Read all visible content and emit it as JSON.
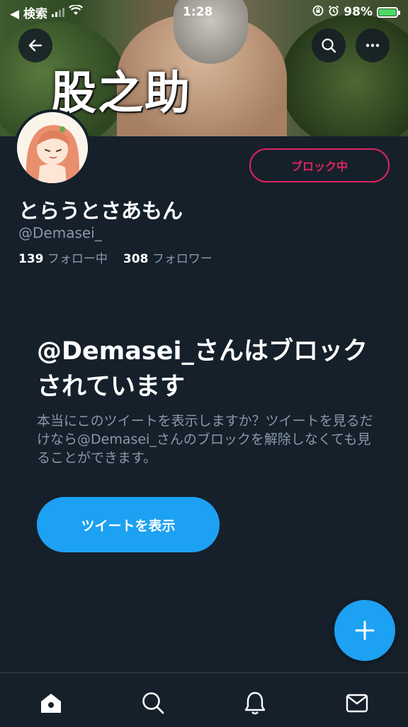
{
  "status_bar": {
    "back_app": "◀ 検索",
    "time": "1:28",
    "battery": "98%"
  },
  "banner": {
    "caption": "股之助"
  },
  "profile": {
    "display_name": "とらうとさあもん",
    "handle": "@Demasei_",
    "following_count": "139",
    "following_label": "フォロー中",
    "followers_count": "308",
    "followers_label": "フォロワー",
    "blocked_button_label": "ブロック中"
  },
  "blocked_notice": {
    "heading": "@Demasei_さんはブロックされています",
    "description": "本当にこのツイートを表示しますか？ツイートを見るだけなら@Demasei_さんのブロックを解除しなくても見ることができます。",
    "view_button_label": "ツイートを表示"
  },
  "colors": {
    "background": "#15202b",
    "accent": "#1da1f2",
    "danger": "#e0245e",
    "secondary_text": "#8899a6"
  },
  "icons": [
    "back-arrow-icon",
    "search-icon",
    "more-icon",
    "plus-icon",
    "home-icon",
    "notifications-icon",
    "messages-icon",
    "wifi-icon",
    "signal-icon",
    "alarm-icon",
    "battery-icon"
  ]
}
